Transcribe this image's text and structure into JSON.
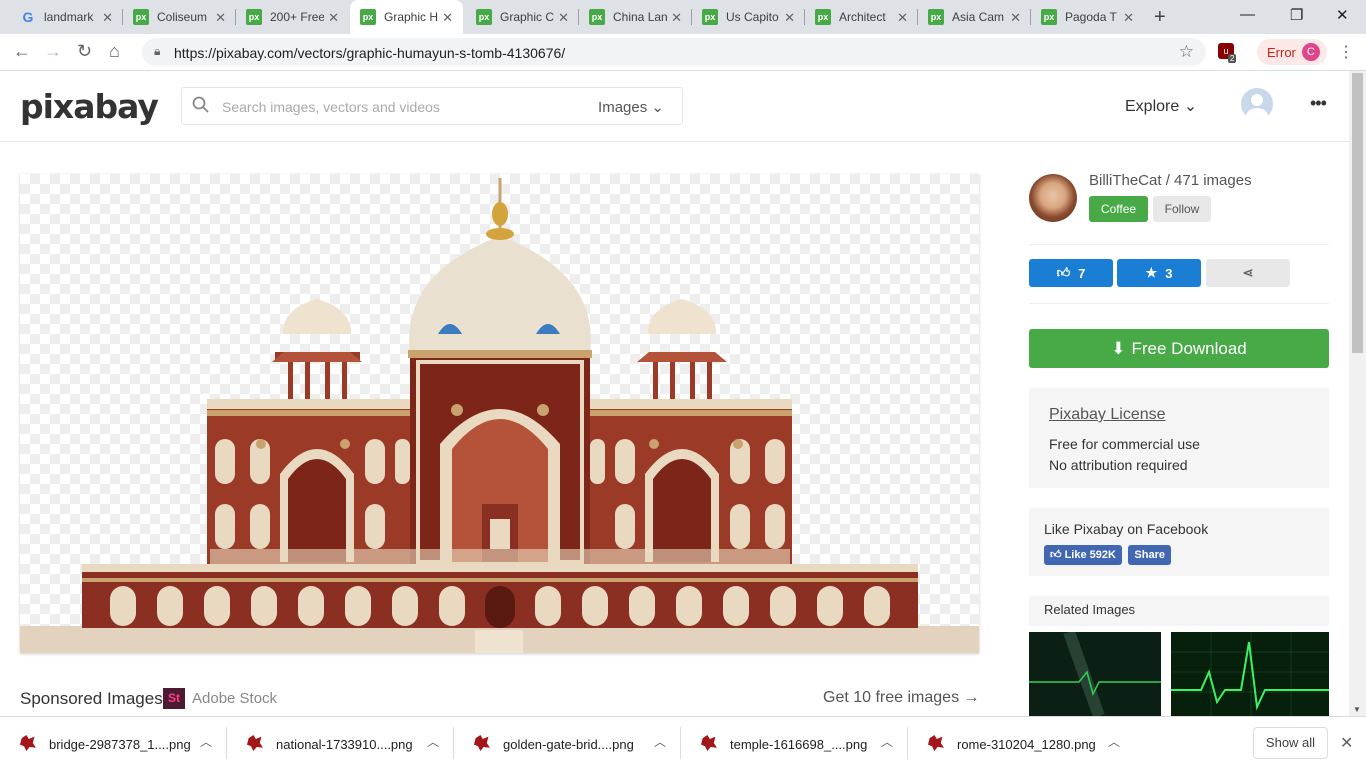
{
  "browser": {
    "tabs": [
      {
        "title": "landmark",
        "icon": "google-icon",
        "fav": "G"
      },
      {
        "title": "Coliseum",
        "icon": "pixabay-icon",
        "fav": "px"
      },
      {
        "title": "200+ Free",
        "icon": "pixabay-icon",
        "fav": "px"
      },
      {
        "title": "Graphic H",
        "icon": "pixabay-icon",
        "fav": "px"
      },
      {
        "title": "Graphic C",
        "icon": "pixabay-icon",
        "fav": "px"
      },
      {
        "title": "China Lan",
        "icon": "pixabay-icon",
        "fav": "px"
      },
      {
        "title": "Us Capito",
        "icon": "pixabay-icon",
        "fav": "px"
      },
      {
        "title": "Architect",
        "icon": "pixabay-icon",
        "fav": "px"
      },
      {
        "title": "Asia Cam",
        "icon": "pixabay-icon",
        "fav": "px"
      },
      {
        "title": "Pagoda T",
        "icon": "pixabay-icon",
        "fav": "px"
      }
    ],
    "url": "https://pixabay.com/vectors/graphic-humayun-s-tomb-4130676/",
    "ext_badge": "2",
    "profile_status": "Error",
    "profile_initial": "C"
  },
  "site": {
    "logo": "pixabay",
    "search_placeholder": "Search images, vectors and videos",
    "search_type": "Images",
    "explore": "Explore"
  },
  "main": {
    "sponsored": "Sponsored Images",
    "stock_logo": "St",
    "stock_name": "Adobe Stock",
    "get_free": "Get 10 free images →"
  },
  "sidebar": {
    "user": "BilliTheCat / 471 images",
    "coffee": "Coffee",
    "follow": "Follow",
    "likes": "7",
    "favorites": "3",
    "download": "Free Download",
    "license_title": "Pixabay License",
    "license_line1": "Free for commercial use",
    "license_line2": "No attribution required",
    "fb_title": "Like Pixabay on Facebook",
    "fb_like": "Like 592K",
    "fb_share": "Share",
    "related": "Related Images"
  },
  "downloads": {
    "items": [
      "bridge-2987378_1....png",
      "national-1733910....png",
      "golden-gate-brid....png",
      "temple-1616698_....png",
      "rome-310204_1280.png"
    ],
    "show_all": "Show all"
  },
  "colors": {
    "accent_green": "#48a947",
    "accent_blue": "#1a7fd4",
    "tomb_red": "#8b2f22"
  }
}
